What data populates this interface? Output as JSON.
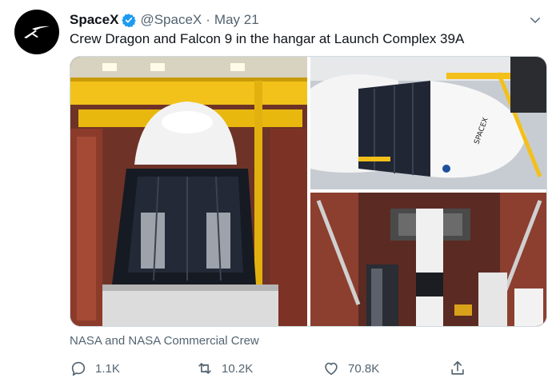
{
  "tweet": {
    "display_name": "SpaceX",
    "handle": "@SpaceX",
    "separator": "·",
    "date": "May 21",
    "text": "Crew Dragon and Falcon 9 in the hangar at Launch Complex 39A",
    "media_credit": "NASA and NASA Commercial Crew"
  },
  "stats": {
    "replies": "1.1K",
    "retweets": "10.2K",
    "likes": "70.8K"
  },
  "photo_text": {
    "rocket_label": "SPACEX"
  },
  "colors": {
    "verified_badge": "#1d9bf0",
    "secondary_text": "#536471",
    "primary_text": "#0f1419",
    "avatar_bg": "#000000"
  },
  "icons": {
    "avatar": "spacex-logo-icon",
    "verified": "verified-badge-icon",
    "more": "chevron-down-icon",
    "reply": "reply-icon",
    "retweet": "retweet-icon",
    "like": "heart-icon",
    "share": "share-icon"
  }
}
